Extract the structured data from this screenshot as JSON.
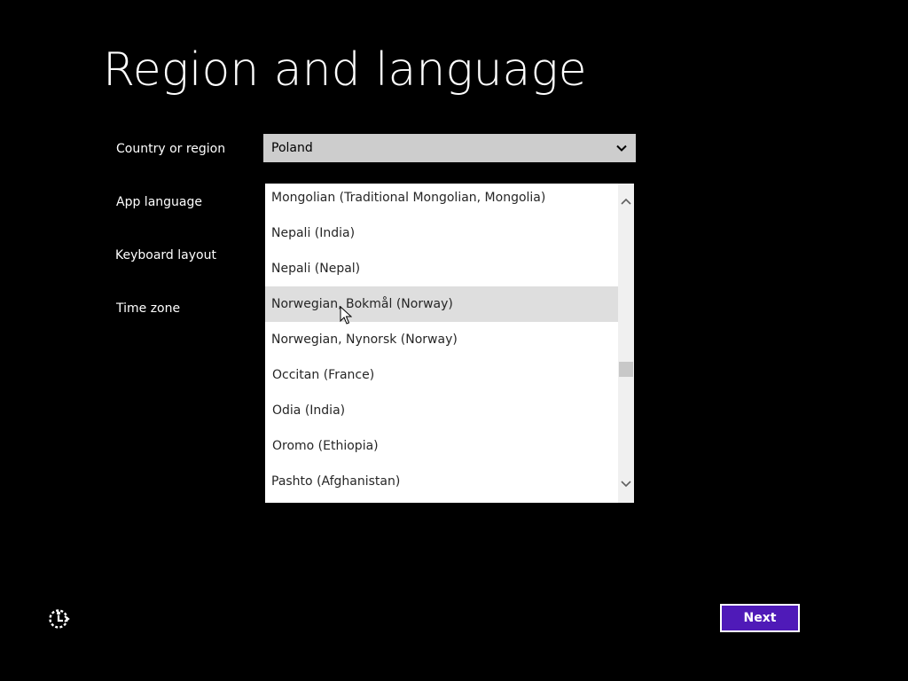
{
  "title": "Region and language",
  "labels": {
    "country": "Country or region",
    "app_language": "App language",
    "keyboard_layout": "Keyboard layout",
    "time_zone": "Time zone"
  },
  "country_select": {
    "value": "Poland",
    "icon": "chevron-down-icon"
  },
  "language_list": {
    "items": [
      "Mongolian (Traditional Mongolian, Mongolia)",
      "Nepali (India)",
      "Nepali (Nepal)",
      "Norwegian, Bokmål (Norway)",
      "Norwegian, Nynorsk (Norway)",
      "Occitan (France)",
      "Odia (India)",
      "Oromo (Ethiopia)",
      "Pashto (Afghanistan)"
    ],
    "hovered": "Norwegian, Bokmål (Norway)"
  },
  "buttons": {
    "next": "Next"
  },
  "colors": {
    "background": "#000000",
    "accent": "#4f1ab8",
    "select_bg": "#cdcdcd",
    "hover_bg": "#dedede"
  },
  "icons": {
    "accessibility": "ease-of-access-icon",
    "pointer": "mouse-cursor-icon"
  }
}
